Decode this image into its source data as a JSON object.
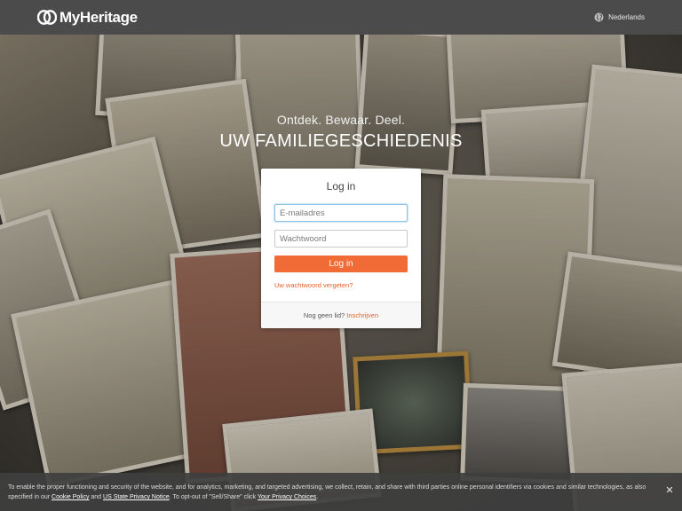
{
  "header": {
    "brand": "MyHeritage",
    "language": "Nederlands"
  },
  "hero": {
    "tagline": "Ontdek. Bewaar. Deel.",
    "headline": "UW FAMILIEGESCHIEDENIS"
  },
  "login": {
    "title": "Log in",
    "email_placeholder": "E-mailadres",
    "password_placeholder": "Wachtwoord",
    "submit_label": "Log in",
    "forgot_label": "Uw wachtwoord vergeten?",
    "no_account_text": "Nog geen lid?",
    "signup_label": "Inschrijven"
  },
  "cookie": {
    "text_1": "To enable the proper functioning and security of the website, and for analytics, marketing, and targeted advertising, we collect, retain, and share with third parties online personal identifiers via cookies and similar technologies, as also specified in our ",
    "cookie_policy_link": "Cookie Policy",
    "text_2": " and ",
    "privacy_notice_link": "US State Privacy Notice",
    "text_3": ". To opt-out of \"Sell/Share\" click ",
    "privacy_choices_link": "Your Privacy Choices",
    "text_4": ".",
    "close_symbol": "✕"
  },
  "colors": {
    "accent": "#f06b35",
    "header_bg": "#4b4b4b"
  },
  "icons": {
    "logo": "myheritage-logo-icon",
    "language": "globe-icon",
    "close": "close-icon"
  }
}
